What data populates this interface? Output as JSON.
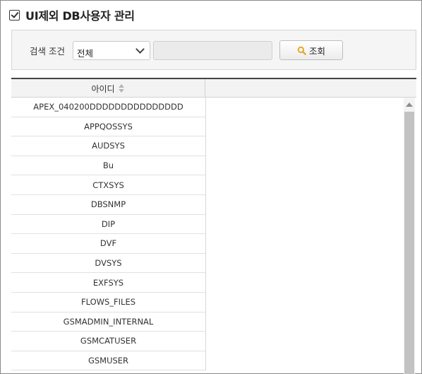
{
  "title": "UI제외 DB사용자 관리",
  "search": {
    "label": "검색 조건",
    "condition_selected": "전체",
    "keyword_value": "",
    "button_label": "조회"
  },
  "grid": {
    "column_header": "아이디",
    "rows": [
      "APEX_040200DDDDDDDDDDDDDDD",
      "APPQOSSYS",
      "AUDSYS",
      "Bu",
      "CTXSYS",
      "DBSNMP",
      "DIP",
      "DVF",
      "DVSYS",
      "EXFSYS",
      "FLOWS_FILES",
      "GSMADMIN_INTERNAL",
      "GSMCATUSER",
      "GSMUSER"
    ]
  },
  "icons": {
    "title": "checkbox-icon",
    "select": "chevron-down-icon",
    "search_button": "search-icon",
    "sort": "sort-icon"
  },
  "colors": {
    "search_icon": "#e8a31c",
    "header_rule": "#444444"
  }
}
